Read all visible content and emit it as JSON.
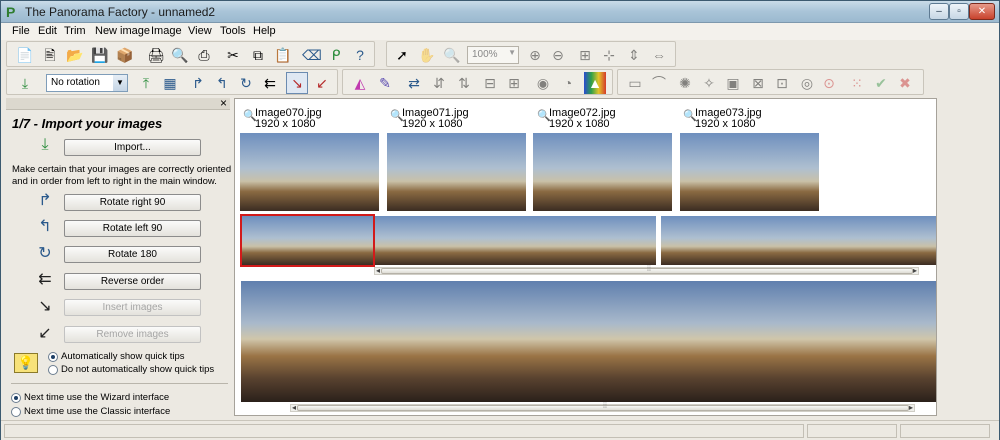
{
  "window": {
    "title": "The Panorama Factory - unnamed2",
    "app_icon": "P"
  },
  "menu": [
    "File",
    "Edit",
    "Trim",
    "New image",
    "Image",
    "View",
    "Tools",
    "Help"
  ],
  "toolbar": {
    "zoom_value": "100%",
    "rotation_value": "No rotation"
  },
  "panel": {
    "title": "1/7 - Import your images",
    "import_label": "Import...",
    "description": "Make certain that your images are correctly oriented and in order from left to right in the main window.",
    "rotate_right_label": "Rotate right 90",
    "rotate_left_label": "Rotate left 90",
    "rotate_180_label": "Rotate 180",
    "reverse_label": "Reverse order",
    "insert_label": "Insert images",
    "remove_label": "Remove images",
    "tips_on": "Automatically show quick tips",
    "tips_off": "Do not automatically show quick tips",
    "wizard_label": "Next time use the Wizard interface",
    "classic_label": "Next time use the Classic interface"
  },
  "thumbnails": [
    {
      "name": "Image070.jpg",
      "size": "1920 x 1080"
    },
    {
      "name": "Image071.jpg",
      "size": "1920 x 1080"
    },
    {
      "name": "Image072.jpg",
      "size": "1920 x 1080"
    },
    {
      "name": "Image073.jpg",
      "size": "1920 x 1080"
    }
  ],
  "colors": {
    "selection": "#d21a1a",
    "title_bar": "#a9c4d8"
  }
}
